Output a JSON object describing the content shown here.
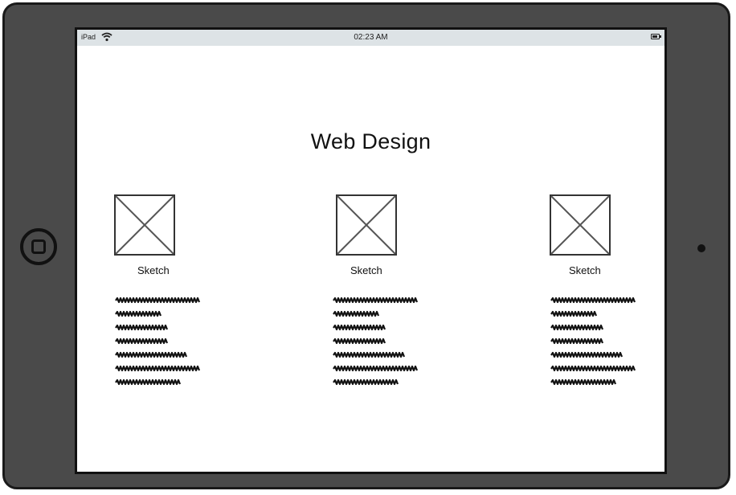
{
  "status_bar": {
    "carrier": "iPad",
    "time": "02:23 AM",
    "wifi_icon": "wifi-icon",
    "battery_icon": "battery-icon"
  },
  "page": {
    "title": "Web Design"
  },
  "columns": [
    {
      "caption": "Sketch",
      "image_icon": "image-placeholder-icon"
    },
    {
      "caption": "Sketch",
      "image_icon": "image-placeholder-icon"
    },
    {
      "caption": "Sketch",
      "image_icon": "image-placeholder-icon"
    }
  ],
  "colors": {
    "device_body": "#4a4a4a",
    "status_bar": "#dde3e6",
    "screen": "#ffffff",
    "ink": "#111111"
  }
}
